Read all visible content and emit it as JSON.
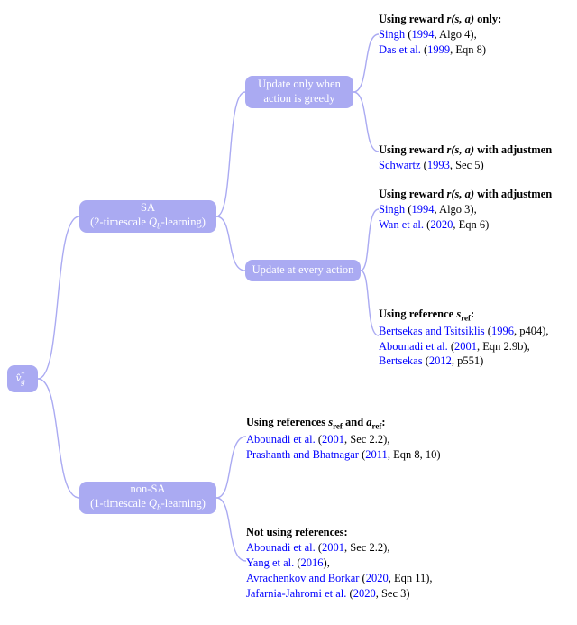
{
  "root": {
    "label": "v̂*_g"
  },
  "level1": {
    "sa": {
      "line1": "SA",
      "line2": "(2-timescale Q_b-learning)"
    },
    "nonsa": {
      "line1": "non-SA",
      "line2": "(1-timescale Q_b-learning)"
    }
  },
  "level2": {
    "update_greedy": {
      "line1": "Update only when",
      "line2": "action is greedy"
    },
    "update_every": {
      "line1": "Update at every action"
    }
  },
  "leaves": {
    "l1": {
      "title_prefix": "Using reward ",
      "title_math": "r(s, a)",
      "title_suffix": " only:",
      "refs": [
        {
          "author": "Singh",
          "year": "1994",
          "detail": ", Algo 4),"
        },
        {
          "author": "Das et al.",
          "year": "1999",
          "detail": ", Eqn 8)"
        }
      ]
    },
    "l2": {
      "title_prefix": "Using reward ",
      "title_math": "r(s, a)",
      "title_suffix": " with adjustment:",
      "refs": [
        {
          "author": "Schwartz",
          "year": "1993",
          "detail": ", Sec 5)"
        }
      ]
    },
    "l3": {
      "title_prefix": "Using reward ",
      "title_math": "r(s, a)",
      "title_suffix": " with adjustment:",
      "refs": [
        {
          "author": "Singh",
          "year": "1994",
          "detail": ", Algo 3),"
        },
        {
          "author": "Wan et al.",
          "year": "2020",
          "detail": ", Eqn 6)"
        }
      ]
    },
    "l4": {
      "title_prefix": "Using reference ",
      "title_math": "s_ref",
      "title_suffix": ":",
      "refs": [
        {
          "author": "Bertsekas and Tsitsiklis",
          "year": "1996",
          "detail": ", p404),"
        },
        {
          "author": "Abounadi et al.",
          "year": "2001",
          "detail": ", Eqn 2.9b),"
        },
        {
          "author": "Bertsekas",
          "year": "2012",
          "detail": ", p551)"
        }
      ]
    },
    "l5": {
      "title_prefix": "Using references ",
      "title_math": "s_ref",
      "title_mid": " and ",
      "title_math2": "a_ref",
      "title_suffix": ":",
      "refs": [
        {
          "author": "Abounadi et al.",
          "year": "2001",
          "detail": ", Sec 2.2),"
        },
        {
          "author": "Prashanth and Bhatnagar",
          "year": "2011",
          "detail": ", Eqn 8, 10)"
        }
      ]
    },
    "l6": {
      "title": "Not using references:",
      "refs": [
        {
          "author": "Abounadi et al.",
          "year": "2001",
          "detail": ", Sec 2.2),"
        },
        {
          "author": "Yang et al.",
          "year": "2016",
          "detail": "),"
        },
        {
          "author": "Avrachenkov and Borkar",
          "year": "2020",
          "detail": ", Eqn 11),"
        },
        {
          "author": "Jafarnia-Jahromi et al.",
          "year": "2020",
          "detail": ", Sec 3)"
        }
      ]
    }
  }
}
